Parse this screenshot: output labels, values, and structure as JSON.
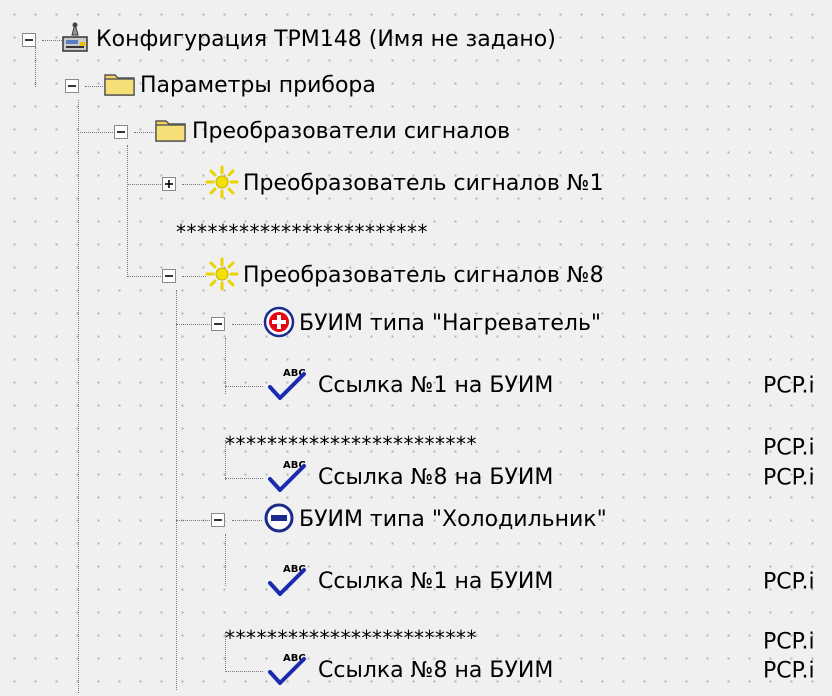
{
  "tree": {
    "root_label": "Конфигурация ТРМ148 (Имя не задано)",
    "device_params_label": "Параметры прибора",
    "converters_label": "Преобразователи сигналов",
    "converter1_label": "Преобразователь сигналов №1",
    "stars_1": "************************",
    "converter8_label": "Преобразователь сигналов №8",
    "heater_label": "БУИМ типа \"Нагреватель\"",
    "heater_link1_label": "Ссылка №1 на БУИМ",
    "heater_link1_value": "PCP.i",
    "heater_stars": "************************",
    "heater_stars_value": "PCP.i",
    "heater_link8_label": "Ссылка №8 на БУИМ",
    "heater_link8_value": "PCP.i",
    "cooler_label": "БУИМ типа \"Холодильник\"",
    "cooler_link1_label": "Ссылка №1 на БУИМ",
    "cooler_link1_value": "PCP.i",
    "cooler_stars": "************************",
    "cooler_stars_value": "PCP.i",
    "cooler_link8_label": "Ссылка №8 на БУИМ",
    "cooler_link8_value": "PCP.i"
  },
  "icons": {
    "root": "device-config-icon",
    "folder": "folder-icon",
    "converter": "sun-icon",
    "heater": "plus-circle-icon",
    "cooler": "minus-circle-icon",
    "link": "abc-check-icon"
  },
  "colors": {
    "background": "#f0f0f0",
    "heater_red": "#e30613",
    "cooler_blue": "#1a2b8c",
    "folder_yellow": "#f2d45c",
    "sun_yellow": "#f4e000"
  }
}
